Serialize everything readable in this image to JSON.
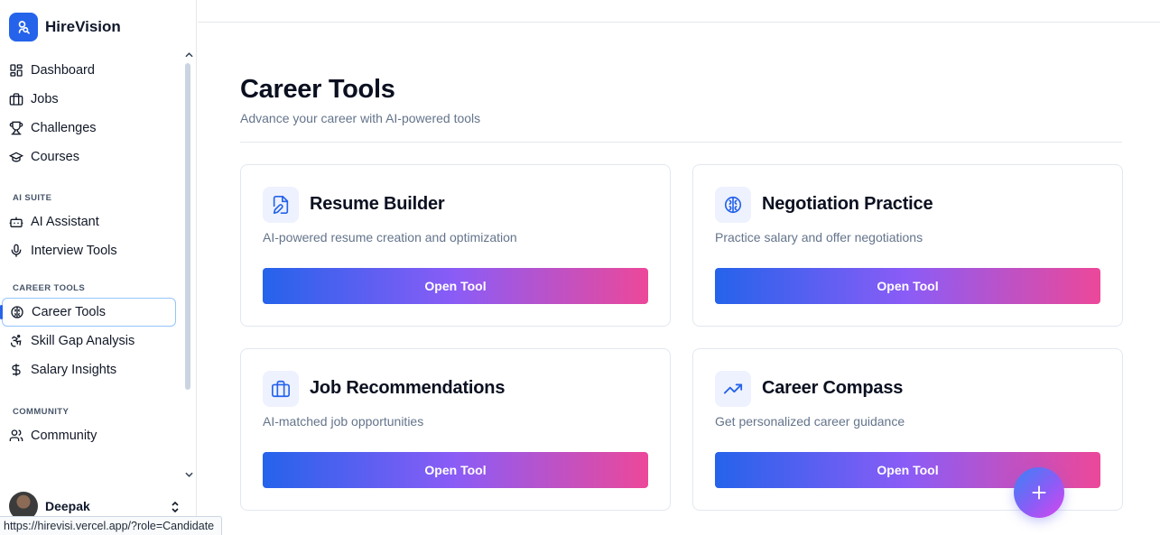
{
  "brand": {
    "name": "HireVision",
    "logo_icon": "user-search-icon",
    "accent": "#2563eb"
  },
  "sidebar": {
    "main_items": [
      {
        "label": "Dashboard",
        "icon": "dashboard-icon"
      },
      {
        "label": "Jobs",
        "icon": "briefcase-icon"
      },
      {
        "label": "Challenges",
        "icon": "trophy-icon"
      },
      {
        "label": "Courses",
        "icon": "graduation-cap-icon"
      }
    ],
    "ai_suite_label": "AI SUITE",
    "ai_suite_items": [
      {
        "label": "AI Assistant",
        "icon": "bot-icon"
      },
      {
        "label": "Interview Tools",
        "icon": "mic-icon"
      }
    ],
    "career_tools_label": "CAREER TOOLS",
    "career_tools_items": [
      {
        "label": "Career Tools",
        "icon": "brain-icon",
        "active": true
      },
      {
        "label": "Skill Gap Analysis",
        "icon": "accessibility-icon"
      },
      {
        "label": "Salary Insights",
        "icon": "dollar-icon"
      }
    ],
    "community_label": "COMMUNITY",
    "community_items": [
      {
        "label": "Community",
        "icon": "users-icon"
      }
    ],
    "user": {
      "name": "Deepak"
    }
  },
  "statusbar": {
    "url": "https://hirevisi.vercel.app/?role=Candidate"
  },
  "main": {
    "title": "Career Tools",
    "subtitle": "Advance your career with AI-powered tools",
    "cards": [
      {
        "title": "Resume Builder",
        "description": "AI-powered resume creation and optimization",
        "button": "Open Tool",
        "icon": "file-edit-icon"
      },
      {
        "title": "Negotiation Practice",
        "description": "Practice salary and offer negotiations",
        "button": "Open Tool",
        "icon": "brain-icon"
      },
      {
        "title": "Job Recommendations",
        "description": "AI-matched job opportunities",
        "button": "Open Tool",
        "icon": "briefcase-icon"
      },
      {
        "title": "Career Compass",
        "description": "Get personalized career guidance",
        "button": "Open Tool",
        "icon": "trending-up-icon"
      }
    ]
  },
  "fab": {
    "icon": "plus-icon"
  },
  "colors": {
    "gradient_start": "#2563eb",
    "gradient_mid": "#8b5cf6",
    "gradient_end": "#ec4899",
    "icon_bg": "#eef2ff"
  }
}
